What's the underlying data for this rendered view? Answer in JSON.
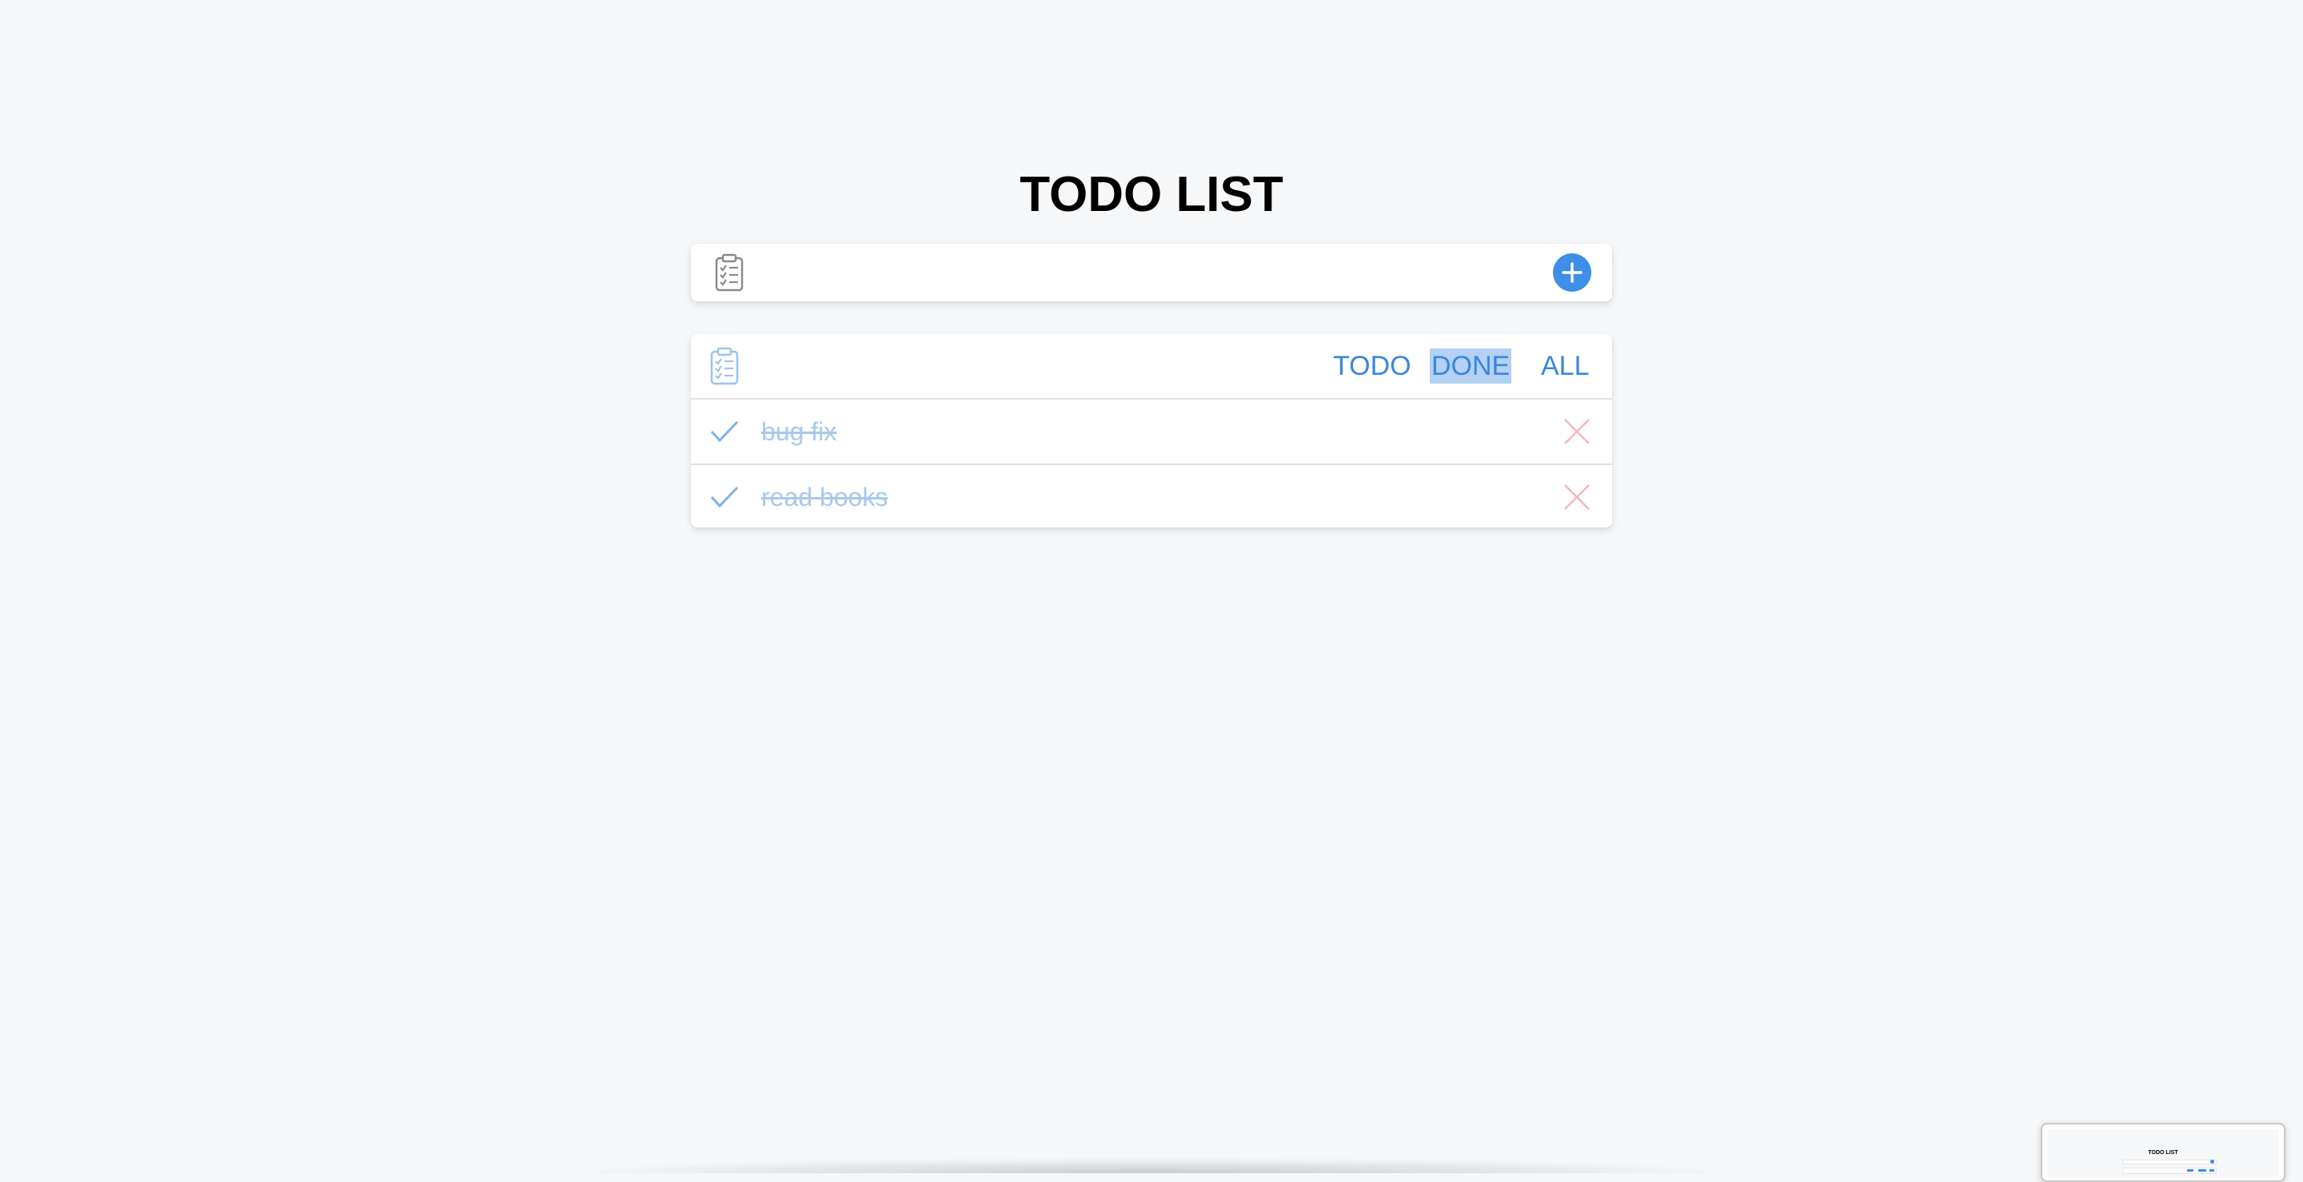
{
  "app": {
    "title": "TODO LIST"
  },
  "add_bar": {
    "input_value": "",
    "input_placeholder": "",
    "icon": "clipboard-checklist-icon",
    "add_button_icon": "plus-icon"
  },
  "filters": {
    "icon": "clipboard-checklist-icon",
    "items": [
      {
        "label": "TODO",
        "selected": false
      },
      {
        "label": "DONE",
        "selected": true
      },
      {
        "label": "ALL",
        "selected": false
      }
    ]
  },
  "todos": [
    {
      "text": "bug fix",
      "done": true,
      "check_icon": "check-icon",
      "delete_icon": "close-icon"
    },
    {
      "text": "read books",
      "done": true,
      "check_icon": "check-icon",
      "delete_icon": "close-icon"
    }
  ],
  "thumbnail": {
    "title": "TODO LIST"
  },
  "colors": {
    "accent": "#3f8ee8",
    "done_text": "#a9c8ec",
    "delete": "#f2b8b8",
    "background": "#f5f7f9",
    "selection_highlight": "#b4d0f2"
  }
}
